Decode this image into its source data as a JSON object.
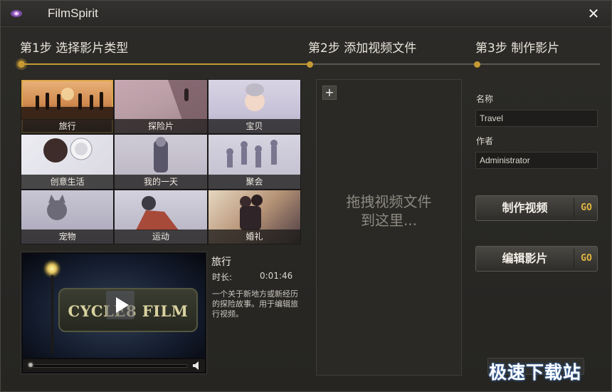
{
  "window": {
    "title": "FilmSpirit"
  },
  "steps": [
    {
      "label": "第1步 选择影片类型"
    },
    {
      "label": "第2步 添加视频文件"
    },
    {
      "label": "第3步 制作影片"
    }
  ],
  "categories": [
    {
      "label": "旅行",
      "selected": true
    },
    {
      "label": "探险片"
    },
    {
      "label": "宝贝"
    },
    {
      "label": "创意生活"
    },
    {
      "label": "我的一天"
    },
    {
      "label": "聚会"
    },
    {
      "label": "宠物"
    },
    {
      "label": "运动"
    },
    {
      "label": "婚礼"
    }
  ],
  "preview": {
    "sign_text": "CYCLE8 FILM",
    "title": "旅行",
    "duration_label": "时长:",
    "duration": "0:01:46",
    "description": "一个关于新地方或新经历的探险故事。用于编辑旅行视频。"
  },
  "drop_area": {
    "add_icon": "+",
    "line1": "拖拽视频文件",
    "line2": "到这里..."
  },
  "form": {
    "name_label": "名称",
    "name_value": "Travel",
    "author_label": "作者",
    "author_value": "Administrator"
  },
  "actions": {
    "make_label": "制作视频",
    "edit_label": "编辑影片",
    "go_label": "GO"
  },
  "watermark": "极速下载站",
  "colors": {
    "accent": "#c59a34",
    "selected_border": "#d9a546",
    "go": "#e2b640"
  }
}
